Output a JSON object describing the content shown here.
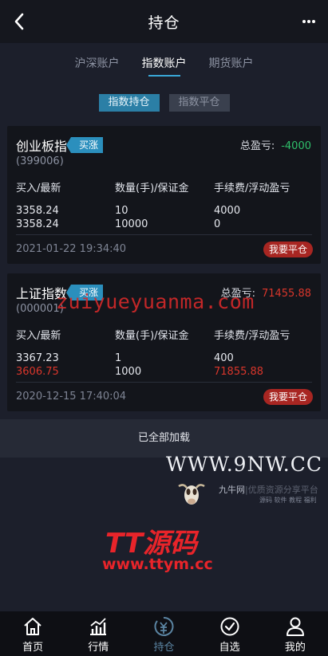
{
  "header": {
    "title": "持仓"
  },
  "tabs": [
    {
      "label": "沪深账户"
    },
    {
      "label": "指数账户"
    },
    {
      "label": "期货账户"
    }
  ],
  "subtabs": [
    {
      "label": "指数持仓"
    },
    {
      "label": "指数平仓"
    }
  ],
  "columns": {
    "c1": "买入/最新",
    "c2": "数量(手)/保证金",
    "c3": "手续费/浮动盈亏"
  },
  "pnl_label": "总盈亏:",
  "positions": [
    {
      "name": "创业板指",
      "direction": "买涨",
      "code": "(399006)",
      "total_pnl": "-4000",
      "buy_price": "3358.24",
      "last_price": "3358.24",
      "qty": "10",
      "margin": "10000",
      "fee": "4000",
      "float_pnl": "0",
      "time": "2021-01-22 19:34:40",
      "close_label": "我要平仓"
    },
    {
      "name": "上证指数",
      "direction": "买涨",
      "code": "(000001)",
      "total_pnl": "71455.88",
      "buy_price": "3367.23",
      "last_price": "3606.75",
      "qty": "1",
      "margin": "1000",
      "fee": "400",
      "float_pnl": "71855.88",
      "time": "2020-12-15 17:40:04",
      "close_label": "我要平仓"
    }
  ],
  "footer_text": "已全部加载",
  "watermarks": {
    "site": "zuiyueyuanma.com",
    "nine": "WWW.9NW.CC",
    "jn_title": "九牛网",
    "jn_faded": "|优质资源分享平台",
    "jn_sub": "源码 软件 教程 福利",
    "tt": "TT源码",
    "ttym": "www.ttym.cc"
  },
  "nav": [
    {
      "label": "首页",
      "icon": "home-icon"
    },
    {
      "label": "行情",
      "icon": "chart-icon"
    },
    {
      "label": "持仓",
      "icon": "yuan-icon"
    },
    {
      "label": "自选",
      "icon": "check-circle-icon"
    },
    {
      "label": "我的",
      "icon": "user-icon"
    }
  ],
  "colors": {
    "accent": "#2b8fbd",
    "loss": "#2fbf6a",
    "profit": "#d9362b",
    "close": "#a82622"
  }
}
